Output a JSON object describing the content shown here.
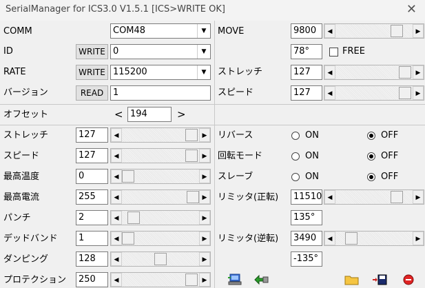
{
  "window": {
    "title": "SerialManager for ICS3.0 V1.5.1 [ICS>WRITE OK]",
    "close_glyph": "✕"
  },
  "labels": {
    "comm": "COMM",
    "id": "ID",
    "rate": "RATE",
    "version": "バージョン",
    "move": "MOVE",
    "stretch_top": "ストレッチ",
    "speed_top": "スピード",
    "offset": "オフセット",
    "stretch": "ストレッチ",
    "speed": "スピード",
    "max_temp": "最高温度",
    "max_current": "最高電流",
    "punch": "パンチ",
    "deadband": "デッドバンド",
    "damping": "ダンピング",
    "protection": "プロテクション",
    "reverse": "リバース",
    "rotation_mode": "回転モード",
    "slave": "スレーブ",
    "limiter_forward": "リミッタ(正転)",
    "limiter_reverse": "リミッタ(逆転)",
    "free": "FREE",
    "on": "ON",
    "off": "OFF"
  },
  "buttons": {
    "write": "WRITE",
    "read": "READ",
    "offset_left": "<",
    "offset_right": ">"
  },
  "fields": {
    "comm": "COM48",
    "id": "0",
    "rate": "115200",
    "version": "1",
    "move": "9800",
    "angle": "78°",
    "stretch_top": "127",
    "speed_top": "127",
    "offset": "194",
    "stretch": "127",
    "speed": "127",
    "max_temp": "0",
    "max_current": "255",
    "punch": "2",
    "deadband": "1",
    "damping": "128",
    "protection": "250",
    "limiter_forward": "11510",
    "limiter_forward_angle": "135°",
    "limiter_reverse": "3490",
    "limiter_reverse_angle": "-135°"
  },
  "radios": {
    "reverse": "OFF",
    "rotation_mode": "OFF",
    "slave": "OFF"
  },
  "free_checked": false,
  "sliders": {
    "move": 0.85,
    "stretch_top": 0.98,
    "speed_top": 0.98,
    "stretch": 0.98,
    "speed": 0.98,
    "max_temp": 0.0,
    "max_current": 1.0,
    "punch": 0.08,
    "deadband": 0.0,
    "damping": 0.5,
    "protection": 0.98,
    "limiter_forward": 0.85,
    "limiter_reverse": 0.15
  }
}
